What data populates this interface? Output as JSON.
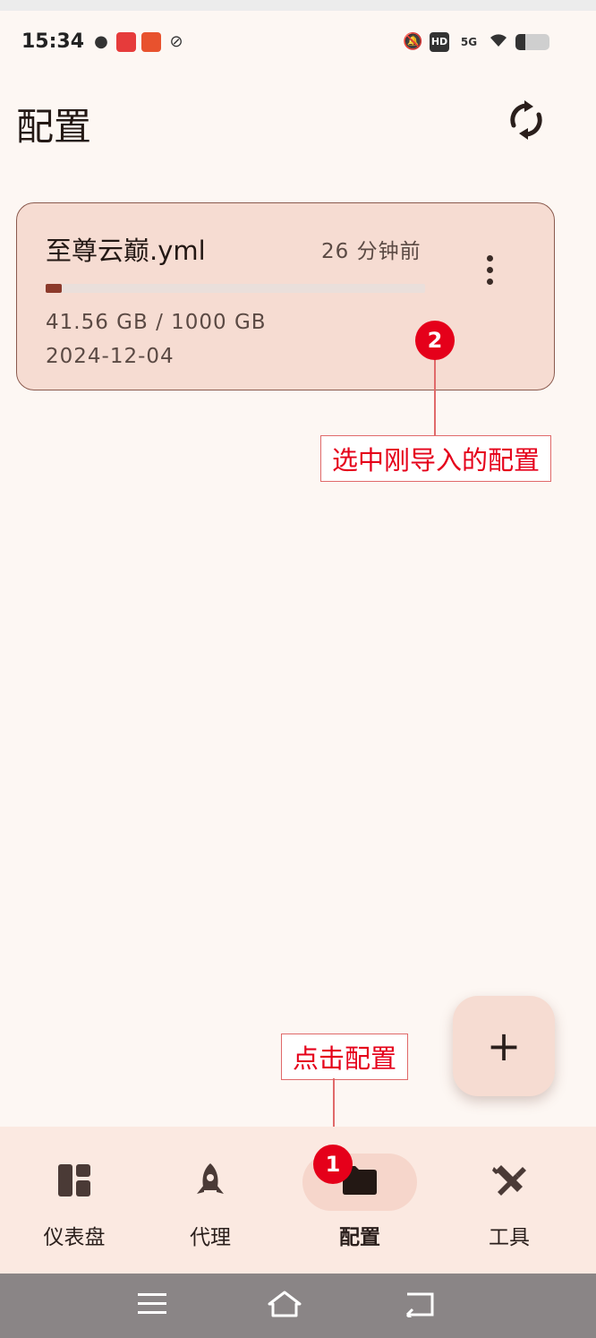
{
  "status_bar": {
    "time": "15:34",
    "left_icons": [
      "wechat-icon",
      "app-red-icon",
      "app-orange-icon",
      "satellite-icon"
    ],
    "right_icons": [
      "bell-off-icon",
      "hd-icon",
      "signal-5g-icon",
      "wifi-icon",
      "battery-icon"
    ],
    "hd_text": "HD",
    "network_text": "5G",
    "battery_level": 0.3
  },
  "header": {
    "title": "配置",
    "refresh_icon": "sync-icon"
  },
  "profiles": [
    {
      "name": "至尊云巅.yml",
      "updated": "26 分钟前",
      "usage": "41.56 GB / 1000 GB",
      "usage_fraction": 0.0416,
      "expire": "2024-12-04",
      "more_icon": "more-vert-icon"
    }
  ],
  "annotations": {
    "step2_number": "2",
    "step2_text": "选中刚导入的配置",
    "step1_number": "1",
    "step1_text": "点击配置"
  },
  "fab": {
    "label": "+"
  },
  "bottom_nav": {
    "items": [
      {
        "label": "仪表盘",
        "icon": "dashboard-icon",
        "active": false
      },
      {
        "label": "代理",
        "icon": "rocket-icon",
        "active": false
      },
      {
        "label": "配置",
        "icon": "folder-icon",
        "active": true
      },
      {
        "label": "工具",
        "icon": "tools-icon",
        "active": false
      }
    ]
  },
  "system_nav": {
    "buttons": [
      "menu-icon",
      "home-icon",
      "back-icon"
    ]
  },
  "colors": {
    "background": "#fdf7f3",
    "card": "#f6dcd2",
    "accent": "#8c3a2b",
    "annotation": "#e5001a",
    "nav_background": "#fbe9e1"
  }
}
